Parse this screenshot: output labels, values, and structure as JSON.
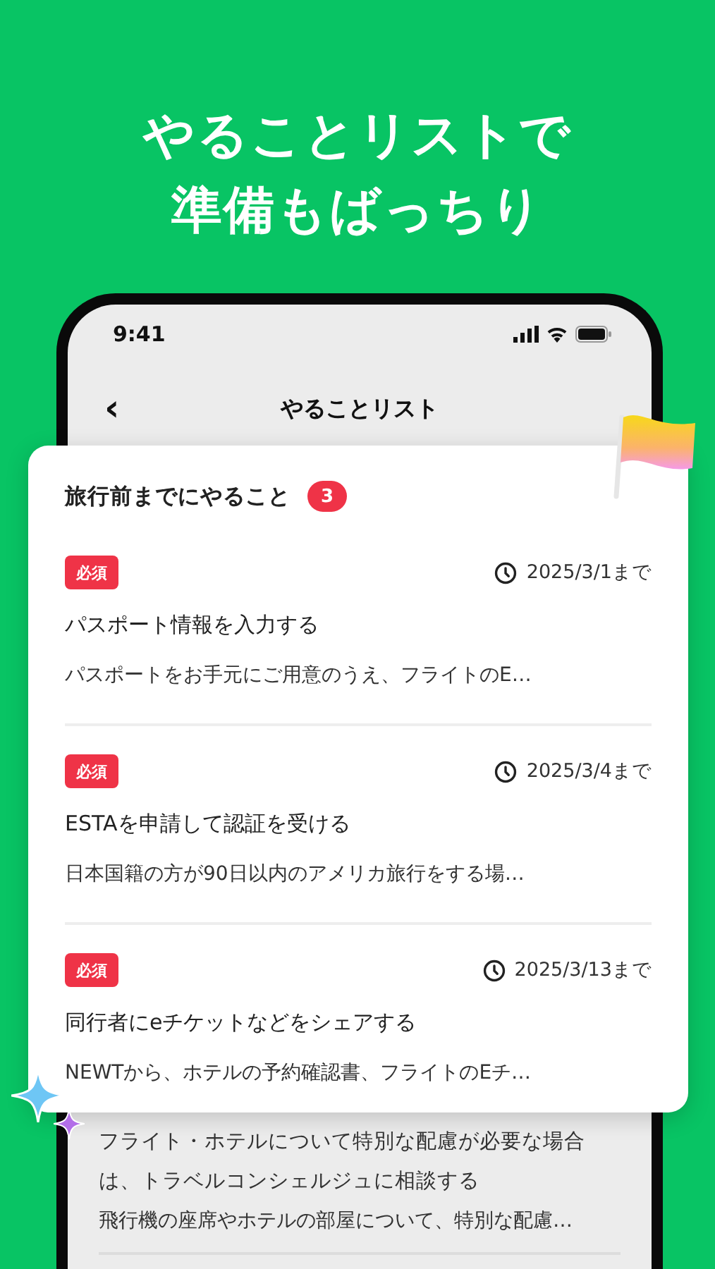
{
  "headline": [
    "やることリストで",
    "準備もばっちり"
  ],
  "status_bar": {
    "time": "9:41"
  },
  "nav": {
    "back": "‹",
    "title": "やることリスト"
  },
  "card": {
    "title": "旅行前までにやること",
    "count": "3",
    "items": [
      {
        "tag": "必須",
        "due": "2025/3/1まで",
        "title": "パスポート情報を入力する",
        "description": "パスポートをお手元にご用意のうえ、フライトのE…"
      },
      {
        "tag": "必須",
        "due": "2025/3/4まで",
        "title": "ESTAを申請して認証を受ける",
        "description": "日本国籍の方が90日以内のアメリカ旅行をする場…"
      },
      {
        "tag": "必須",
        "due": "2025/3/13まで",
        "title": "同行者にeチケットなどをシェアする",
        "description": "NEWTから、ホテルの予約確認書、フライトのEチ…"
      }
    ]
  },
  "background_item": {
    "title": "フライト・ホテルについて特別な配慮が必要な場合は、トラベルコンシェルジュに相談する",
    "description": "飛行機の座席やホテルの部屋について、特別な配慮…"
  }
}
